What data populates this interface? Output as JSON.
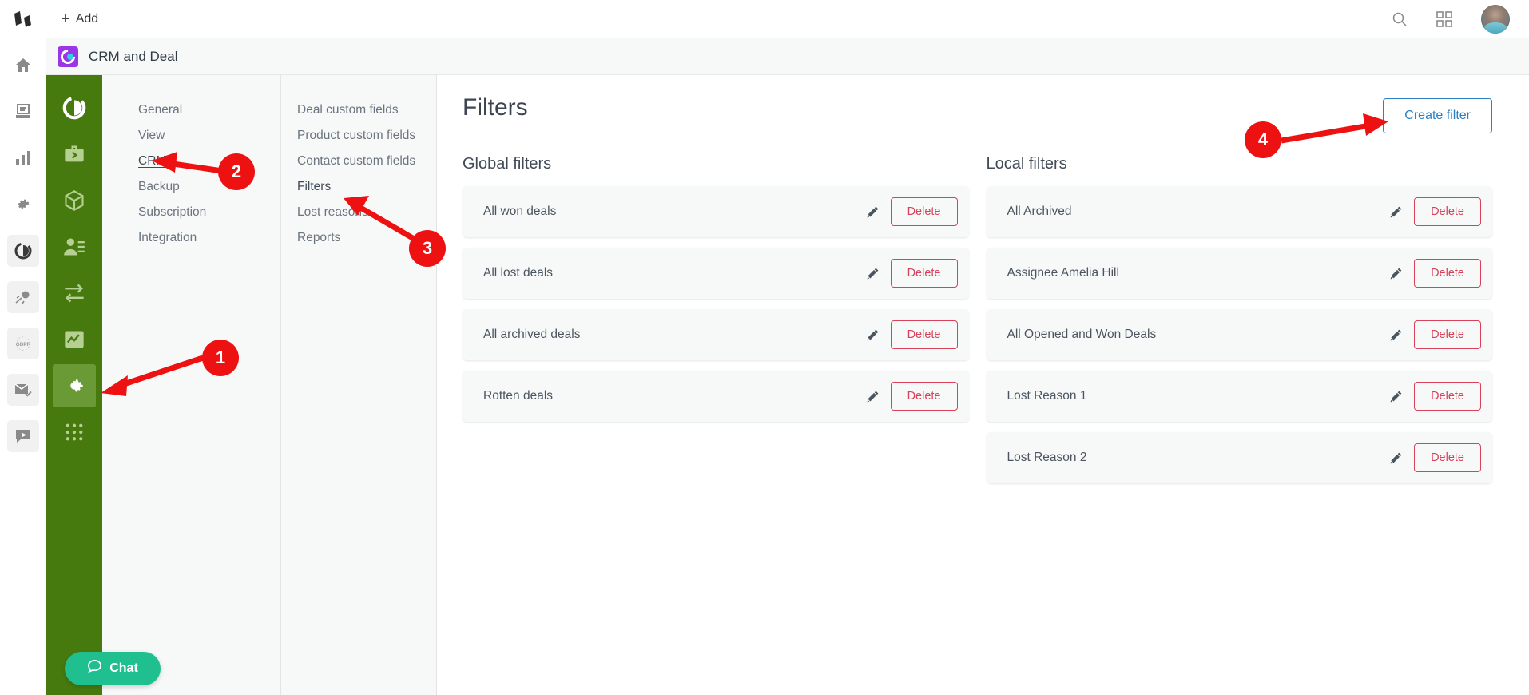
{
  "topbar": {
    "logo_icon": "bitrix-logo-icon",
    "add_label": "Add",
    "add_icon": "plus-icon",
    "search_icon": "search-icon",
    "apps_icon": "grid-apps-icon",
    "avatar_icon": "user-avatar"
  },
  "rail": {
    "items": [
      {
        "name": "home",
        "icon": "home-icon"
      },
      {
        "name": "feed",
        "icon": "feed-icon"
      },
      {
        "name": "analytics",
        "icon": "bar-chart-icon"
      },
      {
        "name": "settings",
        "icon": "gear-icon"
      },
      {
        "name": "crm-and-deal",
        "icon": "crm-circle-icon"
      },
      {
        "name": "marketing",
        "icon": "rocket-ball-icon"
      },
      {
        "name": "gdpr",
        "icon": "gdpr-icon"
      },
      {
        "name": "mail",
        "icon": "mail-check-icon"
      },
      {
        "name": "video",
        "icon": "video-play-icon"
      }
    ]
  },
  "app_header": {
    "logo_icon": "crm-app-logo-icon",
    "title": "CRM and Deal"
  },
  "green_sidebar": {
    "items": [
      {
        "name": "crm-dashboard",
        "icon": "crm-circle-icon"
      },
      {
        "name": "deals",
        "icon": "briefcase-arrow-icon"
      },
      {
        "name": "products",
        "icon": "cube-icon"
      },
      {
        "name": "contacts",
        "icon": "contact-list-icon"
      },
      {
        "name": "transfer",
        "icon": "transfer-arrows-icon"
      },
      {
        "name": "reports",
        "icon": "chart-line-icon"
      },
      {
        "name": "settings",
        "icon": "gear-icon"
      },
      {
        "name": "apps",
        "icon": "dots-grid-icon"
      }
    ],
    "active_index": 6
  },
  "chat": {
    "label": "Chat",
    "icon": "chat-bubble-icon"
  },
  "menu_level1": {
    "items": [
      {
        "label": "General",
        "selected": false
      },
      {
        "label": "View",
        "selected": false
      },
      {
        "label": "CRM",
        "selected": true
      },
      {
        "label": "Backup",
        "selected": false
      },
      {
        "label": "Subscription",
        "selected": false
      },
      {
        "label": "Integration",
        "selected": false
      }
    ]
  },
  "menu_level2": {
    "items": [
      {
        "label": "Deal custom fields",
        "selected": false
      },
      {
        "label": "Product custom fields",
        "selected": false
      },
      {
        "label": "Contact custom fields",
        "selected": false
      },
      {
        "label": "Filters",
        "selected": true
      },
      {
        "label": "Lost reasons",
        "selected": false
      },
      {
        "label": "Reports",
        "selected": false
      }
    ]
  },
  "main": {
    "page_title": "Filters",
    "create_button": "Create filter",
    "columns": [
      {
        "title": "Global filters",
        "cards": [
          {
            "name": "All won deals",
            "edit_icon": "pencil-icon",
            "delete_label": "Delete"
          },
          {
            "name": "All lost deals",
            "edit_icon": "pencil-icon",
            "delete_label": "Delete"
          },
          {
            "name": "All archived deals",
            "edit_icon": "pencil-icon",
            "delete_label": "Delete"
          },
          {
            "name": "Rotten deals",
            "edit_icon": "pencil-icon",
            "delete_label": "Delete"
          }
        ]
      },
      {
        "title": "Local filters",
        "cards": [
          {
            "name": "All Archived",
            "edit_icon": "pencil-icon",
            "delete_label": "Delete"
          },
          {
            "name": "Assignee Amelia Hill",
            "edit_icon": "pencil-icon",
            "delete_label": "Delete"
          },
          {
            "name": "All Opened and Won Deals",
            "edit_icon": "pencil-icon",
            "delete_label": "Delete"
          },
          {
            "name": "Lost Reason 1",
            "edit_icon": "pencil-icon",
            "delete_label": "Delete"
          },
          {
            "name": "Lost Reason 2",
            "edit_icon": "pencil-icon",
            "delete_label": "Delete"
          }
        ]
      }
    ]
  },
  "annotations": {
    "color": "#ee1111",
    "markers": [
      {
        "label": "1",
        "target": "green-sidebar-settings"
      },
      {
        "label": "2",
        "target": "menu-item-crm"
      },
      {
        "label": "3",
        "target": "menu-item-filters"
      },
      {
        "label": "4",
        "target": "create-filter-button"
      }
    ]
  }
}
